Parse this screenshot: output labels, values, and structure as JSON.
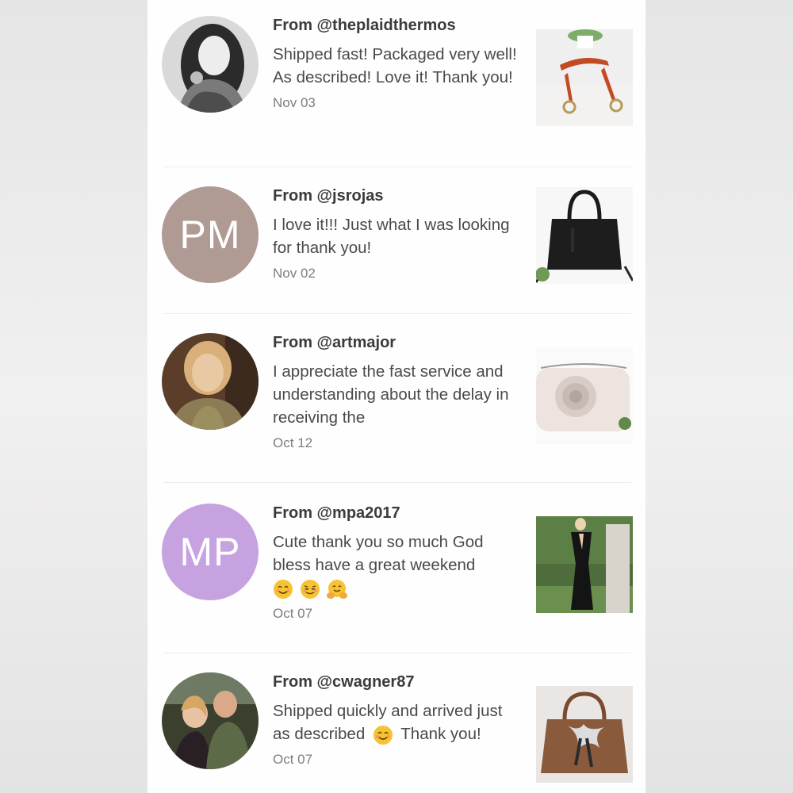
{
  "reviews": [
    {
      "from": "From @theplaidthermos",
      "message": "Shipped fast! Packaged very well! As described! Love it! Thank you!",
      "date": "Nov 03",
      "avatar": {
        "type": "photo",
        "icon": "user-photo-avatar"
      },
      "thumbnail": {
        "icon": "orange-strap-photo"
      }
    },
    {
      "from": "From @jsrojas",
      "message": "I love it!!! Just what I was looking for thank you!",
      "date": "Nov 02",
      "avatar": {
        "type": "initials",
        "initials": "PM",
        "color": "#b09a94"
      },
      "thumbnail": {
        "icon": "black-handbag-photo"
      }
    },
    {
      "from": "From @artmajor",
      "message": "I appreciate the fast service and understanding about the delay in receiving the",
      "date": "Oct 12",
      "avatar": {
        "type": "photo",
        "icon": "user-photo-avatar"
      },
      "thumbnail": {
        "icon": "rose-clutch-photo"
      }
    },
    {
      "from": "From @mpa2017",
      "message": "Cute thank you so much God bless have a great weekend",
      "emoji": [
        "smiling-face-emoji",
        "relieved-face-emoji",
        "hugging-face-emoji"
      ],
      "date": "Oct 07",
      "avatar": {
        "type": "initials",
        "initials": "MP",
        "color": "#c6a2e0"
      },
      "thumbnail": {
        "icon": "black-dress-photo"
      }
    },
    {
      "from": "From @cwagner87",
      "message_before": "Shipped quickly and arrived just as described",
      "message_after": "Thank you!",
      "emoji": [
        "smiling-face-emoji"
      ],
      "date": "Oct 07",
      "avatar": {
        "type": "photo",
        "icon": "user-photo-avatar"
      },
      "thumbnail": {
        "icon": "brown-handbag-photo"
      }
    }
  ]
}
